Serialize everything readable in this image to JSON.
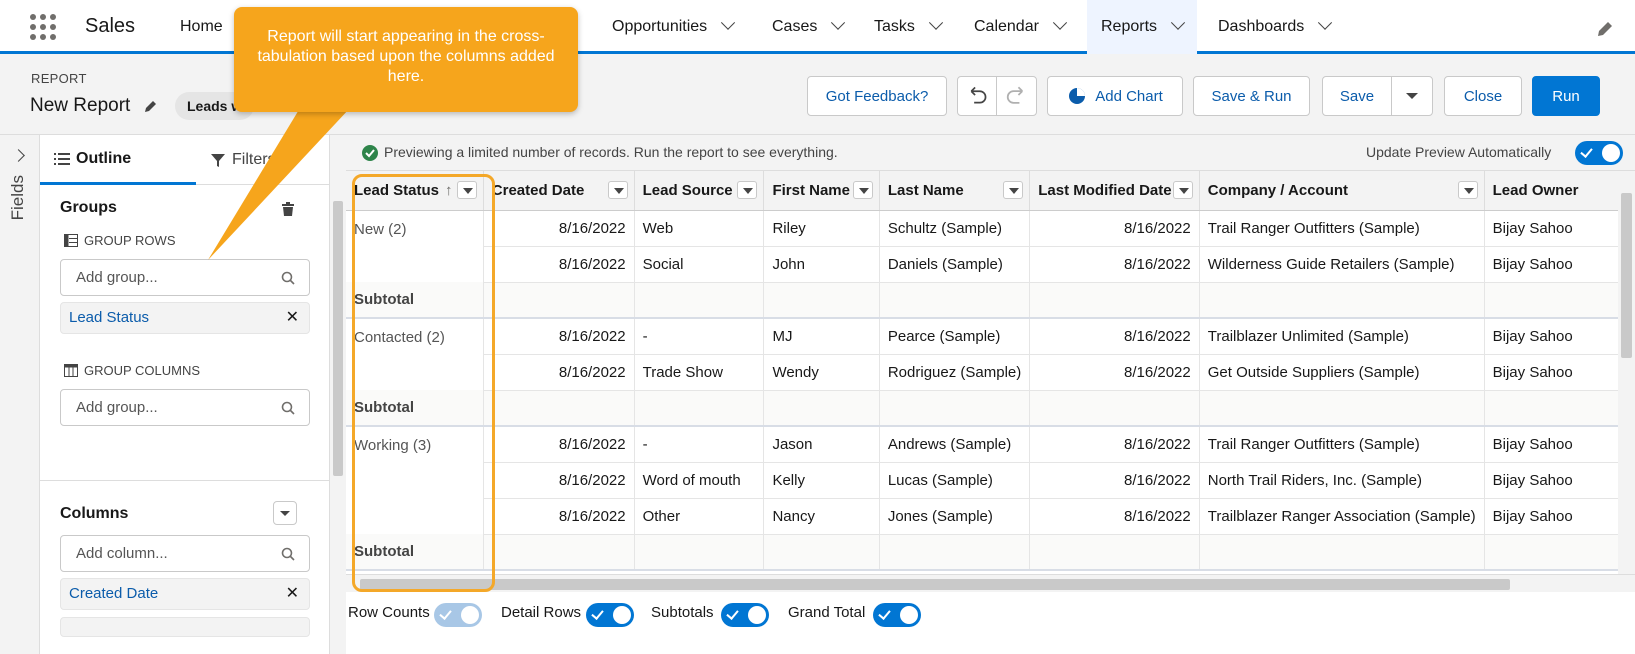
{
  "app": {
    "name": "Sales"
  },
  "nav": {
    "items": [
      {
        "label": "Home",
        "has_menu": false
      },
      {
        "label": "Opportunities",
        "has_menu": true
      },
      {
        "label": "Cases",
        "has_menu": true
      },
      {
        "label": "Tasks",
        "has_menu": true
      },
      {
        "label": "Calendar",
        "has_menu": true
      },
      {
        "label": "Reports",
        "has_menu": true,
        "active": true
      },
      {
        "label": "Dashboards",
        "has_menu": true
      }
    ]
  },
  "header": {
    "eyebrow": "REPORT",
    "title": "New Report",
    "report_type": "Leads w",
    "buttons": {
      "feedback": "Got Feedback?",
      "add_chart": "Add Chart",
      "save_run": "Save & Run",
      "save": "Save",
      "close": "Close",
      "run": "Run"
    }
  },
  "rail": {
    "label": "Fields"
  },
  "panel": {
    "tabs": {
      "outline": "Outline",
      "filters": "Filters"
    },
    "groups_title": "Groups",
    "group_rows_title": "GROUP ROWS",
    "group_rows_placeholder": "Add group...",
    "group_rows": [
      "Lead Status"
    ],
    "group_columns_title": "GROUP COLUMNS",
    "group_columns_placeholder": "Add group...",
    "columns_title": "Columns",
    "columns_placeholder": "Add column...",
    "columns": [
      "Created Date"
    ]
  },
  "preview": {
    "message": "Previewing a limited number of records. Run the report to see everything.",
    "auto_update_label": "Update Preview Automatically",
    "auto_update_on": true
  },
  "table": {
    "headers": [
      "Lead Status",
      "Created Date",
      "Lead Source",
      "First Name",
      "Last Name",
      "Last Modified Date",
      "Company / Account",
      "Lead Owner"
    ],
    "sort_indicator": "↑",
    "subtotal_label": "Subtotal",
    "groups": [
      {
        "label": "New (2)",
        "rows": [
          [
            "8/16/2022",
            "Web",
            "Riley",
            "Schultz (Sample)",
            "8/16/2022",
            "Trail Ranger Outfitters (Sample)",
            "Bijay Sahoo"
          ],
          [
            "8/16/2022",
            "Social",
            "John",
            "Daniels (Sample)",
            "8/16/2022",
            "Wilderness Guide Retailers (Sample)",
            "Bijay Sahoo"
          ]
        ]
      },
      {
        "label": "Contacted (2)",
        "rows": [
          [
            "8/16/2022",
            "-",
            "MJ",
            "Pearce (Sample)",
            "8/16/2022",
            "Trailblazer Unlimited (Sample)",
            "Bijay Sahoo"
          ],
          [
            "8/16/2022",
            "Trade Show",
            "Wendy",
            "Rodriguez (Sample)",
            "8/16/2022",
            "Get Outside Suppliers (Sample)",
            "Bijay Sahoo"
          ]
        ]
      },
      {
        "label": "Working (3)",
        "rows": [
          [
            "8/16/2022",
            "-",
            "Jason",
            "Andrews (Sample)",
            "8/16/2022",
            "Trail Ranger Outfitters (Sample)",
            "Bijay Sahoo"
          ],
          [
            "8/16/2022",
            "Word of mouth",
            "Kelly",
            "Lucas (Sample)",
            "8/16/2022",
            "North Trail Riders, Inc. (Sample)",
            "Bijay Sahoo"
          ],
          [
            "8/16/2022",
            "Other",
            "Nancy",
            "Jones (Sample)",
            "8/16/2022",
            "Trailblazer Ranger Association (Sample)",
            "Bijay Sahoo"
          ]
        ]
      }
    ]
  },
  "footer": {
    "row_counts": {
      "label": "Row Counts",
      "on": false
    },
    "detail_rows": {
      "label": "Detail Rows",
      "on": true
    },
    "subtotals": {
      "label": "Subtotals",
      "on": true
    },
    "grand_total": {
      "label": "Grand Total",
      "on": true
    }
  },
  "callout": {
    "text": "Report will start appearing in the cross-tabulation based upon the columns added here."
  },
  "colors": {
    "brand": "#0176d3",
    "callout": "#f6a51c",
    "highlight": "#f4a829"
  }
}
